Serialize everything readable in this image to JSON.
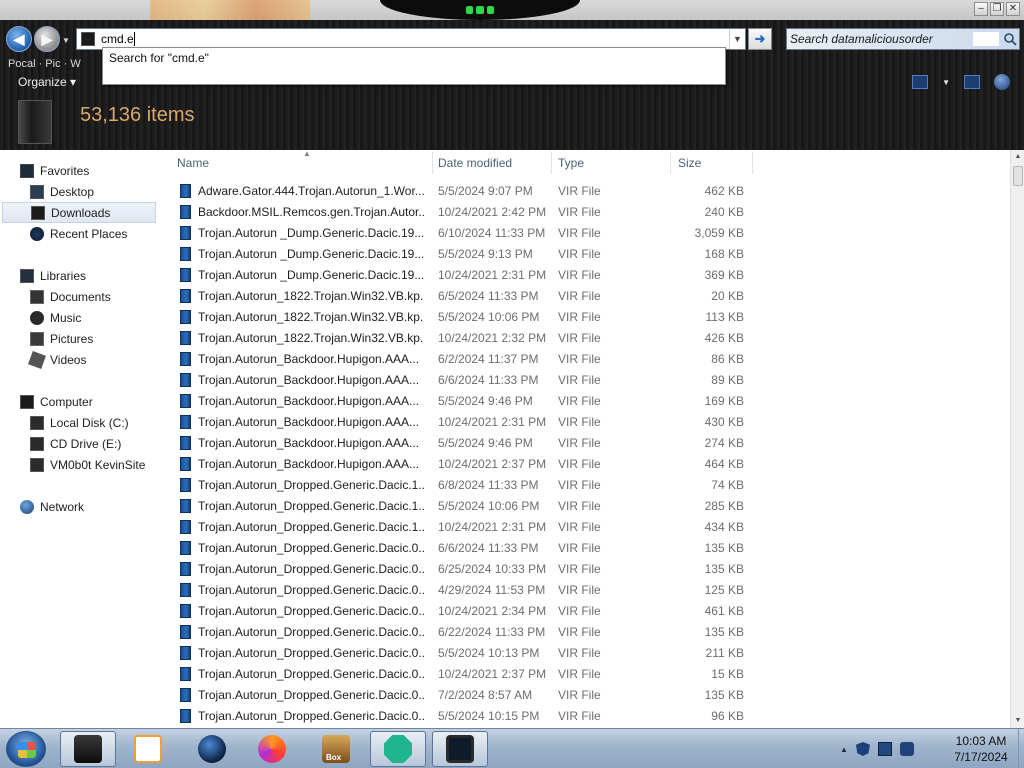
{
  "address_bar": {
    "value": "cmd.e"
  },
  "suggestion": {
    "label": "Search for \"cmd.e\""
  },
  "search_box": {
    "placeholder": "Search datamaliciousorder"
  },
  "toolbar": {
    "organize_label": "Organize ▾"
  },
  "details": {
    "item_count": "53,136 items"
  },
  "navigation": {
    "favorites": {
      "label": "Favorites",
      "items": [
        "Desktop",
        "Downloads",
        "Recent Places"
      ],
      "selected": "Downloads"
    },
    "libraries": {
      "label": "Libraries",
      "items": [
        "Documents",
        "Music",
        "Pictures",
        "Videos"
      ]
    },
    "computer": {
      "label": "Computer",
      "items": [
        "Local Disk (C:)",
        "CD Drive (E:)",
        "VM0b0t KevinSite"
      ]
    },
    "network": {
      "label": "Network"
    }
  },
  "columns": {
    "name": "Name",
    "date": "Date modified",
    "type": "Type",
    "size": "Size"
  },
  "files": [
    {
      "name": "Adware.Gator.444.Trojan.Autorun_1.Wor...",
      "date": "5/5/2024 9:07 PM",
      "type": "VIR File",
      "size": "462 KB"
    },
    {
      "name": "Backdoor.MSIL.Remcos.gen.Trojan.Autor...",
      "date": "10/24/2021 2:42 PM",
      "type": "VIR File",
      "size": "240 KB"
    },
    {
      "name": "Trojan.Autorun _Dump.Generic.Dacic.19...",
      "date": "6/10/2024 11:33 PM",
      "type": "VIR File",
      "size": "3,059 KB"
    },
    {
      "name": "Trojan.Autorun _Dump.Generic.Dacic.19...",
      "date": "5/5/2024 9:13 PM",
      "type": "VIR File",
      "size": "168 KB"
    },
    {
      "name": "Trojan.Autorun _Dump.Generic.Dacic.19...",
      "date": "10/24/2021 2:31 PM",
      "type": "VIR File",
      "size": "369 KB"
    },
    {
      "name": "Trojan.Autorun_1822.Trojan.Win32.VB.kp...",
      "date": "6/5/2024 11:33 PM",
      "type": "VIR File",
      "size": "20 KB"
    },
    {
      "name": "Trojan.Autorun_1822.Trojan.Win32.VB.kp...",
      "date": "5/5/2024 10:06 PM",
      "type": "VIR File",
      "size": "113 KB"
    },
    {
      "name": "Trojan.Autorun_1822.Trojan.Win32.VB.kp...",
      "date": "10/24/2021 2:32 PM",
      "type": "VIR File",
      "size": "426 KB"
    },
    {
      "name": "Trojan.Autorun_Backdoor.Hupigon.AAA...",
      "date": "6/2/2024 11:37 PM",
      "type": "VIR File",
      "size": "86 KB"
    },
    {
      "name": "Trojan.Autorun_Backdoor.Hupigon.AAA...",
      "date": "6/6/2024 11:33 PM",
      "type": "VIR File",
      "size": "89 KB"
    },
    {
      "name": "Trojan.Autorun_Backdoor.Hupigon.AAA...",
      "date": "5/5/2024 9:46 PM",
      "type": "VIR File",
      "size": "169 KB"
    },
    {
      "name": "Trojan.Autorun_Backdoor.Hupigon.AAA...",
      "date": "10/24/2021 2:31 PM",
      "type": "VIR File",
      "size": "430 KB"
    },
    {
      "name": "Trojan.Autorun_Backdoor.Hupigon.AAA...",
      "date": "5/5/2024 9:46 PM",
      "type": "VIR File",
      "size": "274 KB"
    },
    {
      "name": "Trojan.Autorun_Backdoor.Hupigon.AAA...",
      "date": "10/24/2021 2:37 PM",
      "type": "VIR File",
      "size": "464 KB"
    },
    {
      "name": "Trojan.Autorun_Dropped.Generic.Dacic.1...",
      "date": "6/8/2024 11:33 PM",
      "type": "VIR File",
      "size": "74 KB"
    },
    {
      "name": "Trojan.Autorun_Dropped.Generic.Dacic.1...",
      "date": "5/5/2024 10:06 PM",
      "type": "VIR File",
      "size": "285 KB"
    },
    {
      "name": "Trojan.Autorun_Dropped.Generic.Dacic.1...",
      "date": "10/24/2021 2:31 PM",
      "type": "VIR File",
      "size": "434 KB"
    },
    {
      "name": "Trojan.Autorun_Dropped.Generic.Dacic.0...",
      "date": "6/6/2024 11:33 PM",
      "type": "VIR File",
      "size": "135 KB"
    },
    {
      "name": "Trojan.Autorun_Dropped.Generic.Dacic.0...",
      "date": "6/25/2024 10:33 PM",
      "type": "VIR File",
      "size": "135 KB"
    },
    {
      "name": "Trojan.Autorun_Dropped.Generic.Dacic.0...",
      "date": "4/29/2024 11:53 PM",
      "type": "VIR File",
      "size": "125 KB"
    },
    {
      "name": "Trojan.Autorun_Dropped.Generic.Dacic.0...",
      "date": "10/24/2021 2:34 PM",
      "type": "VIR File",
      "size": "461 KB"
    },
    {
      "name": "Trojan.Autorun_Dropped.Generic.Dacic.0...",
      "date": "6/22/2024 11:33 PM",
      "type": "VIR File",
      "size": "135 KB"
    },
    {
      "name": "Trojan.Autorun_Dropped.Generic.Dacic.0...",
      "date": "5/5/2024 10:13 PM",
      "type": "VIR File",
      "size": "211 KB"
    },
    {
      "name": "Trojan.Autorun_Dropped.Generic.Dacic.0...",
      "date": "10/24/2021 2:37 PM",
      "type": "VIR File",
      "size": "15 KB"
    },
    {
      "name": "Trojan.Autorun_Dropped.Generic.Dacic.0...",
      "date": "7/2/2024 8:57 AM",
      "type": "VIR File",
      "size": "135 KB"
    },
    {
      "name": "Trojan.Autorun_Dropped.Generic.Dacic.0...",
      "date": "5/5/2024 10:15 PM",
      "type": "VIR File",
      "size": "96 KB"
    }
  ],
  "taskbar": {
    "apps": [
      {
        "icon": "explorer-icon",
        "active": true
      },
      {
        "icon": "media-player-icon",
        "active": false
      },
      {
        "icon": "globe-icon",
        "active": false
      },
      {
        "icon": "firefox-icon",
        "active": false
      },
      {
        "icon": "sandbox-box-icon",
        "label": "Box",
        "active": false
      },
      {
        "icon": "green-app-icon",
        "active": true
      },
      {
        "icon": "monitor-app-icon",
        "active": true
      }
    ],
    "clock": {
      "time": "10:03 AM",
      "date": "7/17/2024"
    }
  },
  "colors": {
    "accent_count": "#d8a86a",
    "selection": "#dfe7f0",
    "file_icon": "#2b6fbd"
  }
}
